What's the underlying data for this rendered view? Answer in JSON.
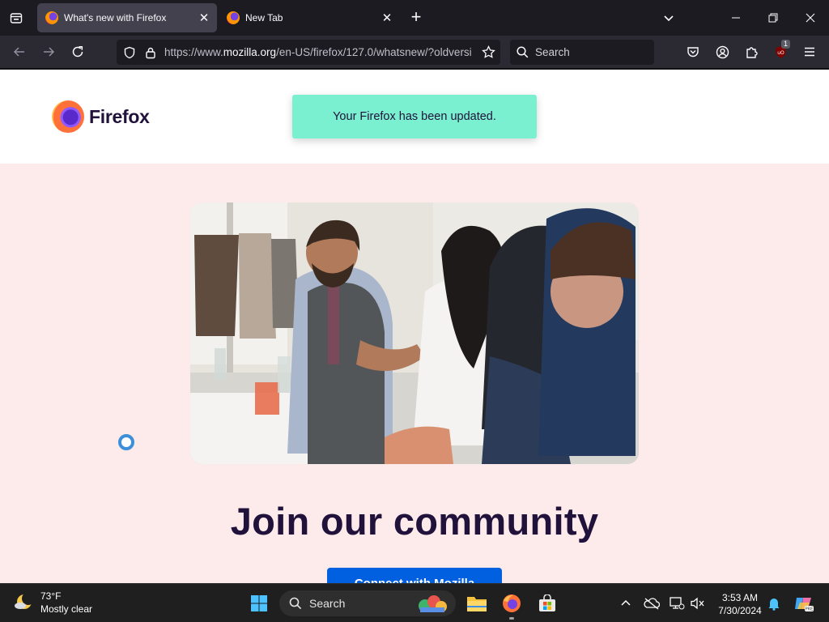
{
  "browser": {
    "tabs": [
      {
        "title": "What's new with Firefox",
        "active": true
      },
      {
        "title": "New Tab",
        "active": false
      }
    ],
    "url": {
      "prefix": "https://www.",
      "host": "mozilla.org",
      "path": "/en-US/firefox/127.0/whatsnew/?oldversi"
    },
    "search_placeholder": "Search",
    "extension_badge": "1"
  },
  "page": {
    "logo_text": "Firefox",
    "notice": "Your Firefox has been updated.",
    "heading": "Join our community",
    "cta_label": "Connect with Mozilla"
  },
  "taskbar": {
    "weather_temp": "73°F",
    "weather_desc": "Mostly clear",
    "search_label": "Search",
    "time": "3:53 AM",
    "date": "7/30/2024"
  },
  "colors": {
    "notice_bg": "#7af0d0",
    "section_bg": "#fdeaea",
    "cta_bg": "#0060df",
    "heading": "#20123a"
  }
}
